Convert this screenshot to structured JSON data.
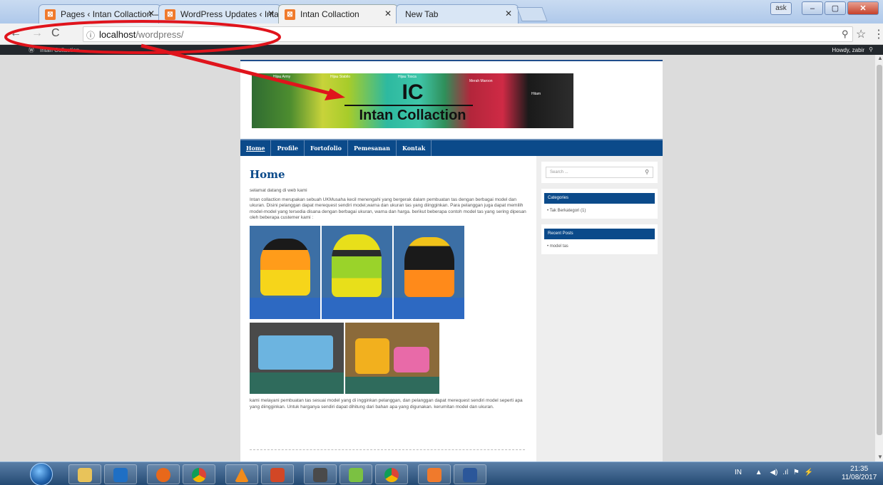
{
  "browser": {
    "tabs": [
      {
        "title": "Pages ‹ Intan Collaction –",
        "active": false
      },
      {
        "title": "WordPress Updates ‹ Inta",
        "active": false
      },
      {
        "title": "Intan Collaction",
        "active": true
      },
      {
        "title": "New Tab",
        "active": false
      }
    ],
    "url_host": "localhost",
    "url_path": "/wordpress/",
    "window_buttons": {
      "minimize": "–",
      "maximize": "▢",
      "close": "✕"
    },
    "lang_badge": "ask"
  },
  "admin_bar": {
    "site_name": "Intan Collaction",
    "howdy": "Howdy, zabir"
  },
  "site": {
    "header_ic": "IC",
    "header_title": "Intan Collaction",
    "header_labels": [
      "Hijau Army",
      "Hijau Stabilo",
      "Hijau Tosca",
      "Merah Maroon",
      "Hitam"
    ],
    "nav": [
      "Home",
      "Profile",
      "Fortofolio",
      "Pemesanan",
      "Kontak"
    ],
    "page_title": "Home",
    "intro": "selamat datang di web kami",
    "paragraph1": "Intan collaction merupakan sebuah UKMusaha kecil menengahi yang bergerak dalam pembuatan tas dengan berbagai model dan ukuran. Disini pelanggan dapat merequest sendiri model,warna dan ukuran tas yang diingginkan. Para pelanggan juga dapat memilih model-model yang tersedia disana dengan berbagai ukuran, warna dan harga. berikut beberapa contoh model tas yang sering dipesan oleh beberapa custemer kami :",
    "paragraph2": "kami melayani pembuatan tas sesuai model yang di ingginkan pelanggan, dan pelanggan dapat merequest sendiri model seperti apa yang diingginkan. Untuk harganya sendiri dapat dihitung dari bahan apa yang digunakan. kerumitan model dan ukuran."
  },
  "sidebar": {
    "search_placeholder": "Search ...",
    "categories_title": "Categories",
    "categories": [
      "Tak Berkategori (1)"
    ],
    "recent_title": "Recent Posts",
    "recent": [
      "model tas"
    ]
  },
  "taskbar": {
    "lang": "IN",
    "time": "21:35",
    "date": "11/08/2017"
  },
  "colors": {
    "annotation": "#e0141c",
    "wp_blue": "#0b4a8a"
  }
}
